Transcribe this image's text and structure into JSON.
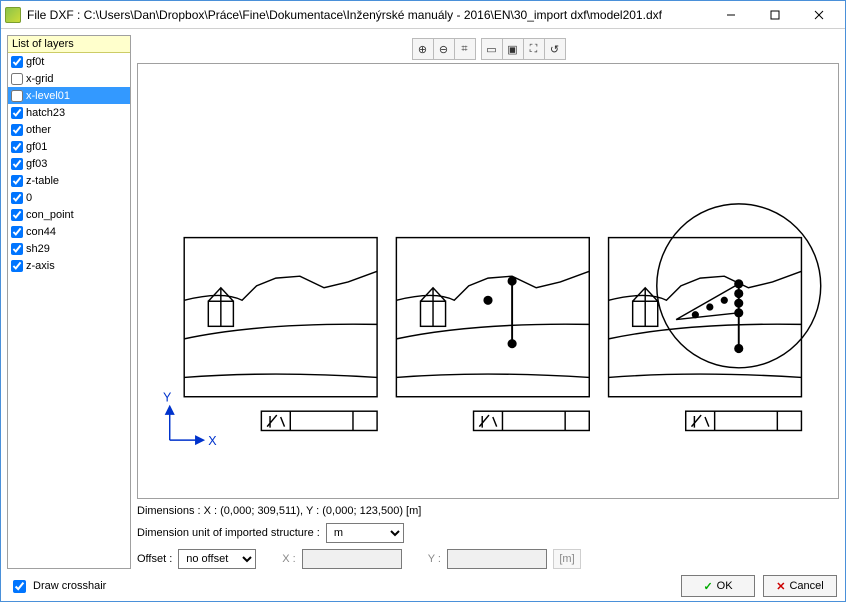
{
  "window": {
    "title": "File DXF : C:\\Users\\Dan\\Dropbox\\Práce\\Fine\\Dokumentace\\Inženýrské manuály - 2016\\EN\\30_import dxf\\model201.dxf"
  },
  "layers": {
    "header": "List of layers",
    "items": [
      {
        "name": "gf0t",
        "checked": true,
        "selected": false
      },
      {
        "name": "x-grid",
        "checked": false,
        "selected": false
      },
      {
        "name": "x-level01",
        "checked": false,
        "selected": true
      },
      {
        "name": "hatch23",
        "checked": true,
        "selected": false
      },
      {
        "name": "other",
        "checked": true,
        "selected": false
      },
      {
        "name": "gf01",
        "checked": true,
        "selected": false
      },
      {
        "name": "gf03",
        "checked": true,
        "selected": false
      },
      {
        "name": "z-table",
        "checked": true,
        "selected": false
      },
      {
        "name": "0",
        "checked": true,
        "selected": false
      },
      {
        "name": "con_point",
        "checked": true,
        "selected": false
      },
      {
        "name": "con44",
        "checked": true,
        "selected": false
      },
      {
        "name": "sh29",
        "checked": true,
        "selected": false
      },
      {
        "name": "z-axis",
        "checked": true,
        "selected": false
      }
    ]
  },
  "toolbar": {
    "buttons": [
      {
        "name": "zoom-in-icon",
        "glyph": "⊕"
      },
      {
        "name": "zoom-out-icon",
        "glyph": "⊖"
      },
      {
        "name": "zoom-window-icon",
        "glyph": "⌗"
      },
      {
        "name": "zoom-extents-icon",
        "glyph": "▭"
      },
      {
        "name": "zoom-selection-icon",
        "glyph": "▣"
      },
      {
        "name": "zoom-full-icon",
        "glyph": "⛶"
      },
      {
        "name": "redraw-icon",
        "glyph": "↺"
      }
    ]
  },
  "canvas": {
    "axis_y": "Y",
    "axis_x": "X"
  },
  "info": {
    "dimensions": "Dimensions : X : (0,000; 309,511), Y : (0,000; 123,500)  [m]",
    "unit_label": "Dimension unit of imported structure :",
    "unit_value": "m",
    "offset_label": "Offset :",
    "offset_value": "no offset",
    "x_label": "X :",
    "x_value": "",
    "y_label": "Y :",
    "y_value": "",
    "xy_unit": "[m]"
  },
  "footer": {
    "crosshair": "Draw crosshair",
    "crosshair_checked": true,
    "ok_glyph": "✓",
    "ok": "OK",
    "cancel_glyph": "✕",
    "cancel": "Cancel"
  }
}
